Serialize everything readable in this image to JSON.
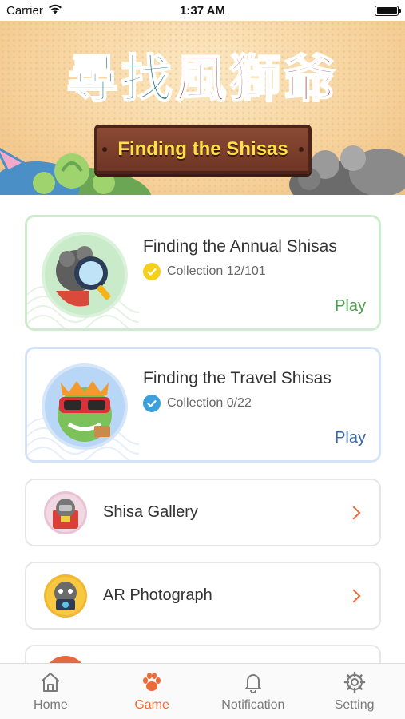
{
  "status_bar": {
    "carrier": "Carrier",
    "time": "1:37 AM"
  },
  "banner": {
    "title_cn_part1": "尋找",
    "title_cn_part2": "風獅爺",
    "sign_text": "Finding the Shisas"
  },
  "cards": [
    {
      "title": "Finding the Annual Shisas",
      "collection": "Collection 12/101",
      "action": "Play",
      "accent": "#4e9e4e"
    },
    {
      "title": "Finding the Travel Shisas",
      "collection": "Collection 0/22",
      "action": "Play",
      "accent": "#3c69a8"
    }
  ],
  "menu": [
    {
      "label": "Shisa Gallery",
      "icon": "shisa-gallery-icon"
    },
    {
      "label": "AR Photograph",
      "icon": "ar-camera-icon"
    }
  ],
  "tabs": [
    {
      "label": "Home",
      "icon": "home-icon",
      "active": false
    },
    {
      "label": "Game",
      "icon": "paw-icon",
      "active": true
    },
    {
      "label": "Notification",
      "icon": "bell-icon",
      "active": false
    },
    {
      "label": "Setting",
      "icon": "gear-icon",
      "active": false
    }
  ],
  "colors": {
    "accent": "#ee6b38",
    "annual_border": "#cdeccd",
    "travel_border": "#d6e3f6"
  }
}
